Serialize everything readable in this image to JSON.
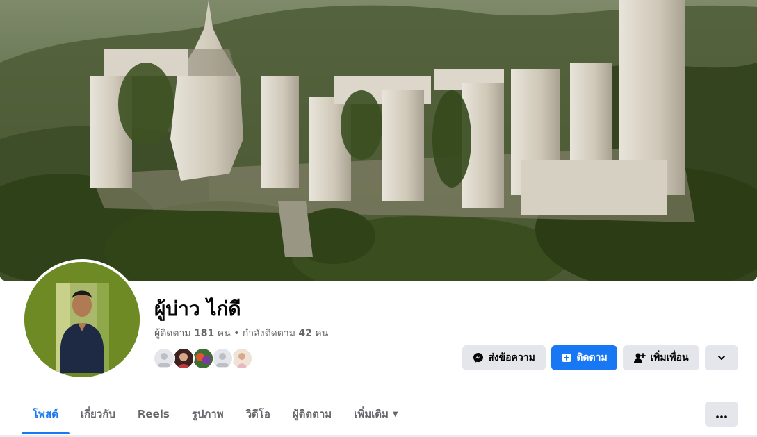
{
  "profile": {
    "name": "ผู้บ่าว ไก่ดี",
    "followers_label": "ผู้ติดตาม",
    "followers_count": "181",
    "followers_unit": "คน",
    "separator": "•",
    "following_label": "กำลังติดตาม",
    "following_count": "42",
    "following_unit": "คน"
  },
  "actions": {
    "message_label": "ส่งข้อความ",
    "follow_label": "ติดตาม",
    "add_friend_label": "เพิ่มเพื่อน",
    "more_icon": "chevron-down-icon"
  },
  "tabs": [
    {
      "label": "โพสต์",
      "active": true
    },
    {
      "label": "เกี่ยวกับ",
      "active": false
    },
    {
      "label": "Reels",
      "active": false
    },
    {
      "label": "รูปภาพ",
      "active": false
    },
    {
      "label": "วิดีโอ",
      "active": false
    },
    {
      "label": "ผู้ติดตาม",
      "active": false
    },
    {
      "label": "เพิ่มเติม",
      "active": false
    }
  ],
  "colors": {
    "accent": "#1877f2",
    "button_grey": "#e4e6eb",
    "secondary_text": "#65676b",
    "primary_text": "#050505"
  }
}
